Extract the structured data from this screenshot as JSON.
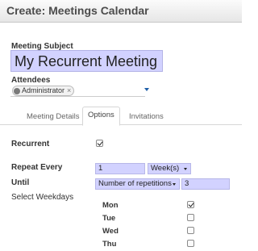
{
  "window": {
    "title": "Create: Meetings Calendar"
  },
  "form": {
    "subject_label": "Meeting Subject",
    "subject_value": "My Recurrent Meeting",
    "attendees_label": "Attendees",
    "attendees": [
      {
        "name": "Administrator"
      }
    ],
    "remove_glyph": "×"
  },
  "tabs": [
    {
      "label": "Meeting Details",
      "active": false
    },
    {
      "label": "Options",
      "active": true
    },
    {
      "label": "Invitations",
      "active": false
    }
  ],
  "options": {
    "recurrent_label": "Recurrent",
    "recurrent_checked": true,
    "repeat_every_label": "Repeat Every",
    "repeat_every_value": "1",
    "repeat_unit": "Week(s)",
    "until_label": "Until",
    "until_mode": "Number of repetitions",
    "until_count": "3",
    "select_weekdays_label": "Select Weekdays",
    "weekdays": [
      {
        "label": "Mon",
        "checked": true
      },
      {
        "label": "Tue",
        "checked": false
      },
      {
        "label": "Wed",
        "checked": false
      },
      {
        "label": "Thu",
        "checked": false
      }
    ]
  },
  "colors": {
    "required_field_bg": "#d2d2ff",
    "tag_bg": "#f2f2f2",
    "dropdown_caret": "#1f5fa8"
  },
  "icons": [
    "avatar-icon",
    "remove-tag-icon",
    "dropdown-arrow-icon",
    "checkbox-icon"
  ]
}
